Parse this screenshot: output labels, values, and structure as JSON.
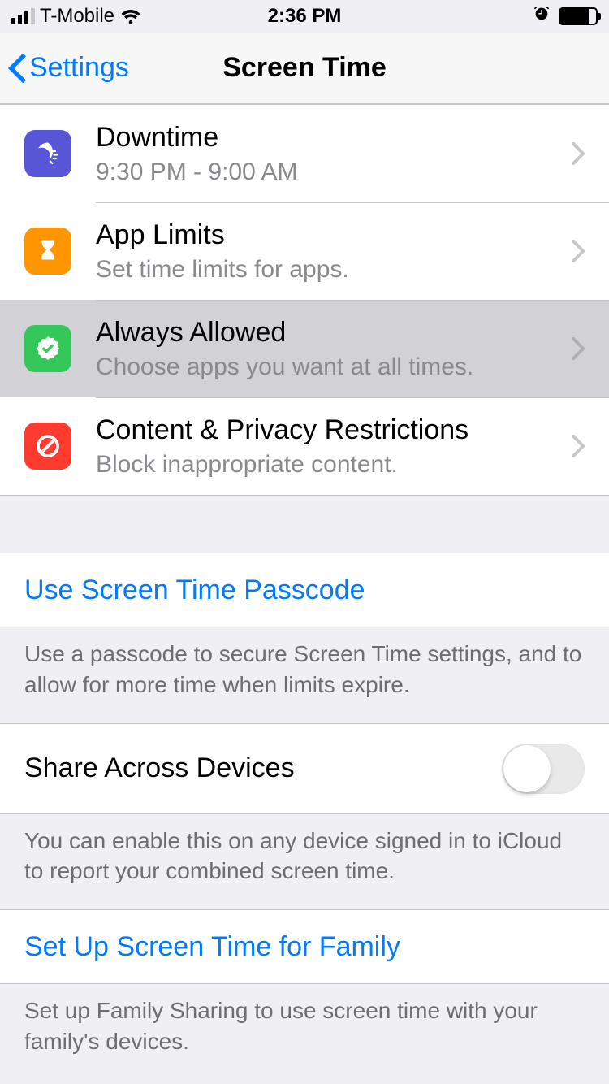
{
  "status": {
    "carrier": "T-Mobile",
    "time": "2:36 PM"
  },
  "nav": {
    "back": "Settings",
    "title": "Screen Time"
  },
  "rows": {
    "downtime": {
      "title": "Downtime",
      "sub": "9:30 PM - 9:00 AM"
    },
    "applimits": {
      "title": "App Limits",
      "sub": "Set time limits for apps."
    },
    "always": {
      "title": "Always Allowed",
      "sub": "Choose apps you want at all times."
    },
    "content": {
      "title": "Content & Privacy Restrictions",
      "sub": "Block inappropriate content."
    }
  },
  "passcode": {
    "link": "Use Screen Time Passcode",
    "footer": "Use a passcode to secure Screen Time settings, and to allow for more time when limits expire."
  },
  "share": {
    "label": "Share Across Devices",
    "on": false,
    "footer": "You can enable this on any device signed in to iCloud to report your combined screen time."
  },
  "family": {
    "link": "Set Up Screen Time for Family",
    "footer": "Set up Family Sharing to use screen time with your family's devices."
  }
}
